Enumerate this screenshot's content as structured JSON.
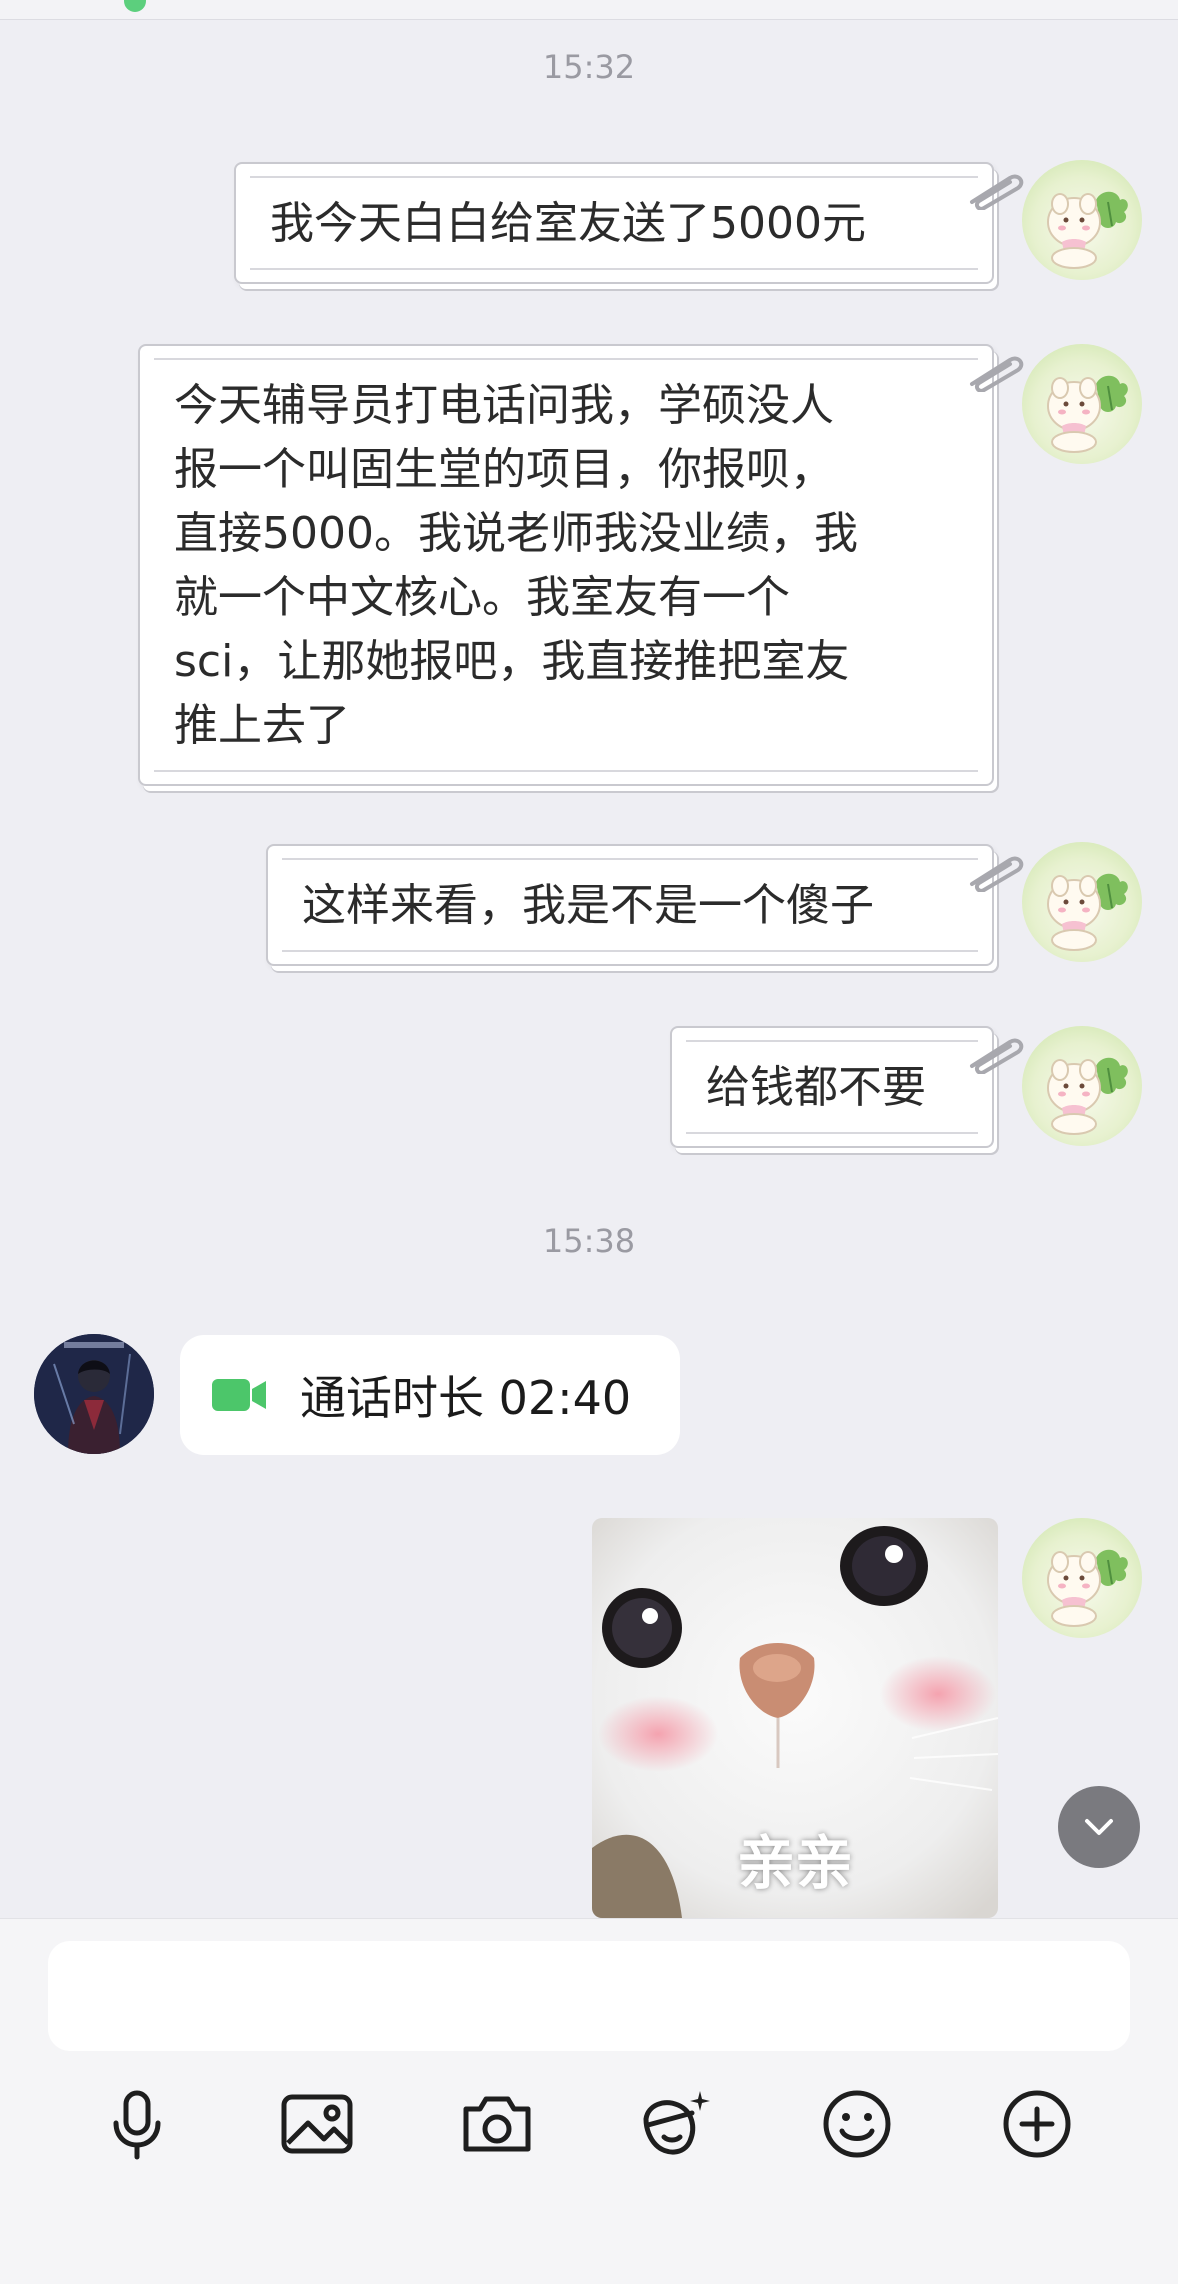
{
  "timestamps": [
    "15:32",
    "15:38"
  ],
  "messages": [
    {
      "sender": "self",
      "text": "我今天白白给室友送了5000元"
    },
    {
      "sender": "self",
      "lines": [
        "今天辅导员打电话问我，学硕没人",
        "报一个叫固生堂的项目，你报呗，",
        "直接5000。我说老师我没业绩，我",
        "就一个中文核心。我室友有一个",
        "sci，让那她报吧，我直接推把室友",
        "推上去了"
      ]
    },
    {
      "sender": "self",
      "text": "这样来看，我是不是一个傻子"
    },
    {
      "sender": "self",
      "text": "给钱都不要"
    }
  ],
  "call": {
    "sender": "other",
    "icon": "video-call-icon",
    "text": "通话时长 02:40"
  },
  "sticker": {
    "sender": "self",
    "caption": "亲亲"
  },
  "input": {
    "value": "",
    "placeholder": ""
  },
  "toolbar": [
    "microphone-icon",
    "image-icon",
    "camera-icon",
    "magic-face-icon",
    "emoji-icon",
    "plus-icon"
  ],
  "colors": {
    "background": "#eeeef3",
    "call_icon": "#4cc66a",
    "scroll_button": "#7a7a7f"
  }
}
